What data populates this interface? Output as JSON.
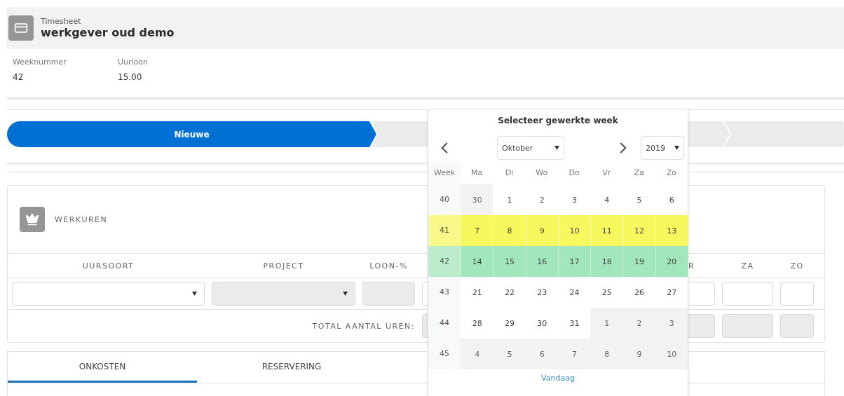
{
  "header": {
    "subtitle": "Timesheet",
    "title": "werkgever oud demo"
  },
  "fields": [
    {
      "label": "Weeknummer",
      "value": "42"
    },
    {
      "label": "Uurloon",
      "value": "15.00"
    }
  ],
  "steps": [
    {
      "label": "Nieuwe",
      "selected": true
    },
    {
      "selected": false
    },
    {
      "selected": false
    }
  ],
  "werkuren": {
    "title": "WERKUREN",
    "columns": [
      "UURSOORT",
      "PROJECT",
      "LOON-%",
      "",
      "R",
      "ZA",
      "ZO"
    ],
    "entry_fields": [
      {
        "kind": "select",
        "disabled": false
      },
      {
        "kind": "select",
        "disabled": true
      },
      {
        "kind": "input",
        "disabled": true
      },
      {
        "kind": "input",
        "disabled": false
      },
      {
        "kind": "input",
        "disabled": false
      },
      {
        "kind": "input",
        "disabled": false
      },
      {
        "kind": "input",
        "disabled": false
      }
    ],
    "total_label": "TOTAL AANTAL UREN:"
  },
  "tabs": [
    {
      "label": "ONKOSTEN",
      "selected": true
    },
    {
      "label": "RESERVERING",
      "selected": false
    }
  ],
  "week_picker": {
    "title": "Selecteer gewerkte week",
    "month": "Oktober",
    "year": "2019",
    "week_heading": "Week",
    "weekdays": [
      "Ma",
      "Di",
      "Wo",
      "Do",
      "Vr",
      "Za",
      "Zo"
    ],
    "weeks": [
      {
        "number": "40",
        "days": [
          {
            "day": "30",
            "outside": true
          },
          {
            "day": "1",
            "outside": false
          },
          {
            "day": "2",
            "outside": false
          },
          {
            "day": "3",
            "outside": false
          },
          {
            "day": "4",
            "outside": false
          },
          {
            "day": "5",
            "outside": false
          },
          {
            "day": "6",
            "outside": false
          }
        ]
      },
      {
        "number": "41",
        "color": "#f7f75e",
        "days": [
          {
            "day": "7",
            "outside": false
          },
          {
            "day": "8",
            "outside": false
          },
          {
            "day": "9",
            "outside": false
          },
          {
            "day": "10",
            "outside": false
          },
          {
            "day": "11",
            "outside": false
          },
          {
            "day": "12",
            "outside": false
          },
          {
            "day": "13",
            "outside": false
          }
        ]
      },
      {
        "number": "42",
        "color": "#a2e6bb",
        "days": [
          {
            "day": "14",
            "outside": false
          },
          {
            "day": "15",
            "outside": false
          },
          {
            "day": "16",
            "outside": false
          },
          {
            "day": "17",
            "outside": false
          },
          {
            "day": "18",
            "outside": false
          },
          {
            "day": "19",
            "outside": false
          },
          {
            "day": "20",
            "outside": false
          }
        ]
      },
      {
        "number": "43",
        "days": [
          {
            "day": "21",
            "outside": false
          },
          {
            "day": "22",
            "outside": false
          },
          {
            "day": "23",
            "outside": false
          },
          {
            "day": "24",
            "outside": false
          },
          {
            "day": "25",
            "outside": false
          },
          {
            "day": "26",
            "outside": false
          },
          {
            "day": "27",
            "outside": false
          }
        ]
      },
      {
        "number": "44",
        "days": [
          {
            "day": "28",
            "outside": false
          },
          {
            "day": "29",
            "outside": false
          },
          {
            "day": "30",
            "outside": false
          },
          {
            "day": "31",
            "outside": false
          },
          {
            "day": "1",
            "outside": true
          },
          {
            "day": "2",
            "outside": true
          },
          {
            "day": "3",
            "outside": true
          }
        ]
      },
      {
        "number": "45",
        "days": [
          {
            "day": "4",
            "outside": true
          },
          {
            "day": "5",
            "outside": true
          },
          {
            "day": "6",
            "outside": true
          },
          {
            "day": "7",
            "outside": true
          },
          {
            "day": "8",
            "outside": true
          },
          {
            "day": "9",
            "outside": true
          },
          {
            "day": "10",
            "outside": true
          }
        ]
      }
    ],
    "today_link": "Vandaag"
  }
}
